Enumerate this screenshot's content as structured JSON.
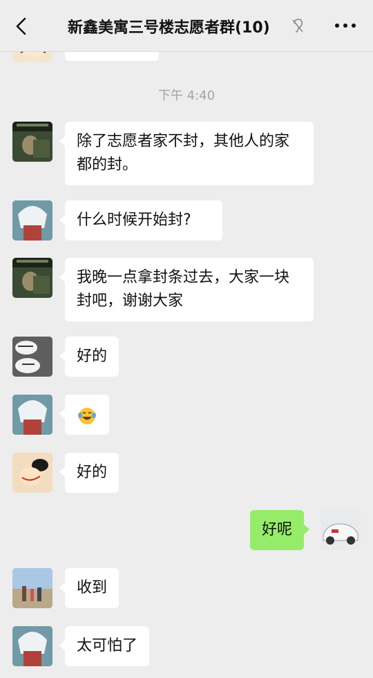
{
  "header": {
    "title": "新鑫美寓三号楼志愿者群(10)",
    "back_icon": "chevron-left-icon",
    "mute_icon": "mute-ear-icon",
    "more_icon": "more-dots-icon"
  },
  "timestamp": "下午 4:40",
  "messages": [
    {
      "side": "left",
      "avatar": "avatar-user-a",
      "text": "除了志愿者家不封，其他人的家都的封。"
    },
    {
      "side": "left",
      "avatar": "avatar-user-b",
      "text": "什么时候开始封?"
    },
    {
      "side": "left",
      "avatar": "avatar-user-a",
      "text": "我晚一点拿封条过去，大家一块封吧，谢谢大家"
    },
    {
      "side": "left",
      "avatar": "avatar-user-c",
      "text": "好的"
    },
    {
      "side": "left",
      "avatar": "avatar-user-b",
      "emoji": "laughing-tears-emoji"
    },
    {
      "side": "left",
      "avatar": "avatar-user-d",
      "text": "好的"
    },
    {
      "side": "right",
      "avatar": "avatar-self",
      "text": "好呢"
    },
    {
      "side": "left",
      "avatar": "avatar-user-e",
      "text": "收到"
    },
    {
      "side": "left",
      "avatar": "avatar-user-b",
      "text": "太可怕了"
    }
  ],
  "colors": {
    "background": "#ededed",
    "bubble_left": "#ffffff",
    "bubble_right": "#95ec69",
    "timestamp": "#a3a3a3"
  }
}
